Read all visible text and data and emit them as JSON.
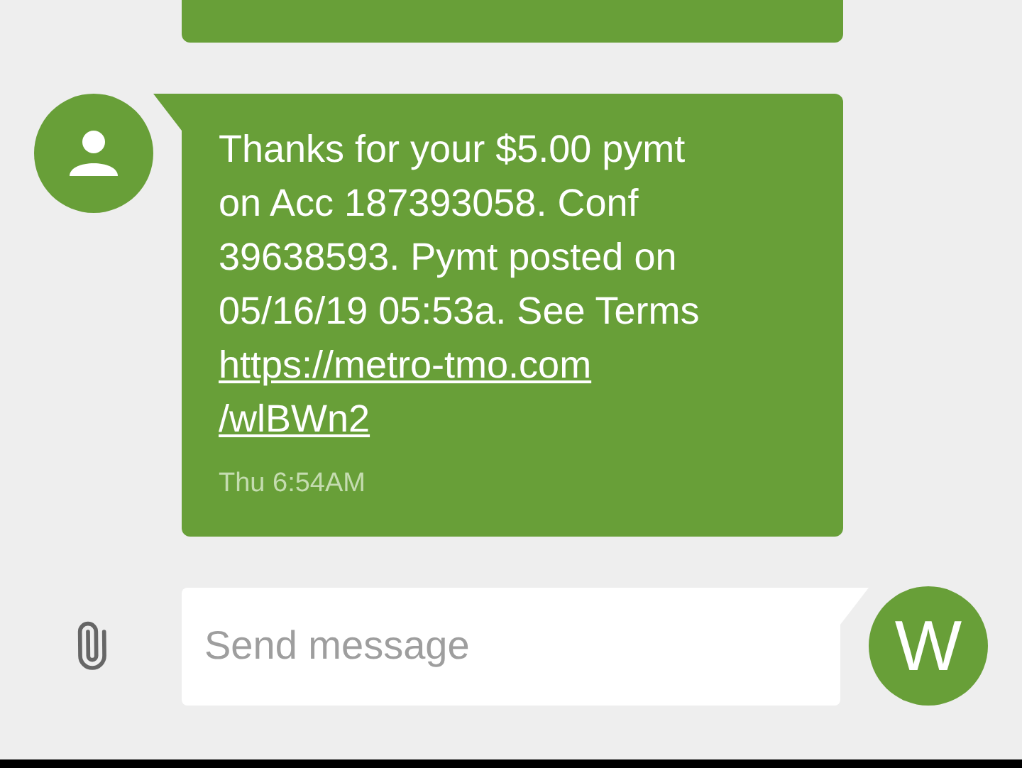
{
  "messages": [
    {
      "kind": "clipped"
    },
    {
      "kind": "incoming",
      "lines": [
        {
          "kind": "text",
          "text": "Thanks for your $5.00 pymt"
        },
        {
          "kind": "text",
          "text": "on Acc 187393058. Conf"
        },
        {
          "kind": "text",
          "text": "39638593. Pymt posted on"
        },
        {
          "kind": "text",
          "text": "05/16/19 05:53a. See Terms"
        },
        {
          "kind": "link",
          "text": "https://metro-tmo.com"
        },
        {
          "kind": "link",
          "text": "/wlBWn2"
        }
      ],
      "time": "Thu 6:54AM"
    }
  ],
  "composer": {
    "placeholder": "Send message",
    "sender_initial": "W"
  }
}
